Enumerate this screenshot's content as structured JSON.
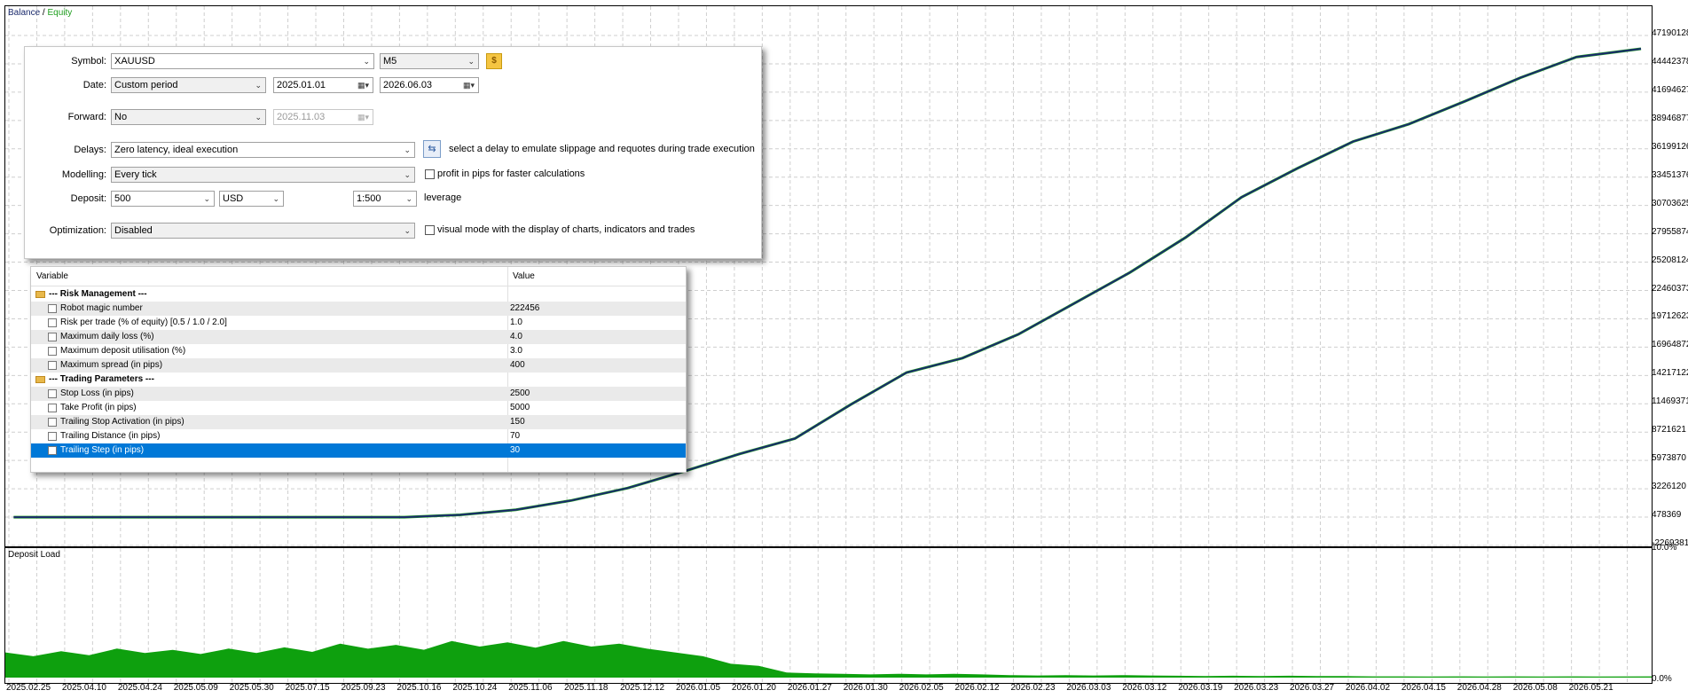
{
  "chart": {
    "legend_balance": "Balance",
    "legend_sep": " / ",
    "legend_equity": "Equity",
    "y_labels": [
      "47190128",
      "44442378",
      "41694627",
      "38946877",
      "36199126",
      "33451376",
      "30703625",
      "27955874",
      "25208124",
      "22460373",
      "19712623",
      "16964872",
      "14217122",
      "11469371",
      "8721621",
      "5973870",
      "3226120",
      "478369",
      "-2269381"
    ],
    "load_title": "Deposit Load",
    "load_y_top": "10.0%",
    "load_y_bottom": "0.0%",
    "x_labels": [
      "2025.02.25",
      "2025.04.10",
      "2025.04.24",
      "2025.05.09",
      "2025.05.30",
      "2025.07.15",
      "2025.09.23",
      "2025.10.16",
      "2025.10.24",
      "2025.11.06",
      "2025.11.18",
      "2025.12.12",
      "2026.01.05",
      "2026.01.20",
      "2026.01.27",
      "2026.01.30",
      "2026.02.05",
      "2026.02.12",
      "2026.02.23",
      "2026.03.03",
      "2026.03.12",
      "2026.03.19",
      "2026.03.23",
      "2026.03.27",
      "2026.04.02",
      "2026.04.15",
      "2026.04.28",
      "2026.05.08",
      "2026.05.21"
    ],
    "balance_color": "#1a2a6c",
    "equity_color": "#1c9e1c",
    "load_color": "#0ea00e"
  },
  "chart_data": {
    "type": "line",
    "series": [
      {
        "name": "Balance",
        "values": [
          478369,
          478369,
          478369,
          478369,
          478369,
          478369,
          478369,
          478369,
          700000,
          1200000,
          2100000,
          3300000,
          4900000,
          6600000,
          8100000,
          11400000,
          14500000,
          15900000,
          18200000,
          21200000,
          24200000,
          27600000,
          31500000,
          34300000,
          36900000,
          38600000,
          40800000,
          43100000,
          45100000
        ]
      },
      {
        "name": "Equity",
        "values": [
          478369,
          478369,
          478369,
          478369,
          478369,
          478369,
          478369,
          478369,
          700000,
          1200000,
          2100000,
          3300000,
          4900000,
          6600000,
          8100000,
          11400000,
          14500000,
          15900000,
          18200000,
          21200000,
          24200000,
          27600000,
          31500000,
          34300000,
          36900000,
          38600000,
          40800000,
          43100000,
          45100000
        ]
      }
    ],
    "ylim": [
      -2269381,
      47190128
    ],
    "deposit_load": {
      "ylim": [
        0,
        10.0
      ],
      "values": [
        2.0,
        2.1,
        2.3,
        2.2,
        2.3,
        2.4,
        2.7,
        2.6,
        2.9,
        2.8,
        2.9,
        2.7,
        2.0,
        1.1,
        0.4,
        0.3,
        0.3,
        0.3,
        0.2,
        0.2,
        0.2,
        0.15,
        0.15,
        0.15,
        0.12,
        0.1,
        0.1,
        0.1,
        0.1
      ]
    }
  },
  "settings": {
    "symbol_label": "Symbol:",
    "symbol_value": "XAUUSD",
    "timeframe": "M5",
    "date_label": "Date:",
    "date_mode": "Custom period",
    "date_from": "2025.01.01",
    "date_to": "2026.06.03",
    "forward_label": "Forward:",
    "forward_value": "No",
    "forward_date": "2025.11.03",
    "delays_label": "Delays:",
    "delays_value": "Zero latency, ideal execution",
    "delays_note": "select a delay to emulate slippage and requotes during trade execution",
    "modelling_label": "Modelling:",
    "modelling_value": "Every tick",
    "modelling_note": "profit in pips for faster calculations",
    "deposit_label": "Deposit:",
    "deposit_value": "500",
    "currency": "USD",
    "leverage_value": "1:500",
    "leverage_label": "leverage",
    "optimization_label": "Optimization:",
    "optimization_value": "Disabled",
    "visual_note": "visual mode with the display of charts, indicators and trades"
  },
  "params": {
    "col_variable": "Variable",
    "col_value": "Value",
    "group1": "--- Risk Management ---",
    "group2": "--- Trading Parameters ---",
    "rows": [
      {
        "name": "Robot magic number",
        "value": "222456"
      },
      {
        "name": "Risk per trade (% of equity) [0.5 / 1.0 / 2.0]",
        "value": "1.0"
      },
      {
        "name": "Maximum daily loss (%)",
        "value": "4.0"
      },
      {
        "name": "Maximum deposit utilisation (%)",
        "value": "3.0"
      },
      {
        "name": "Maximum spread (in pips)",
        "value": "400"
      },
      {
        "name": "Stop Loss (in pips)",
        "value": "2500"
      },
      {
        "name": "Take Profit (in pips)",
        "value": "5000"
      },
      {
        "name": "Trailing Stop Activation (in pips)",
        "value": "150"
      },
      {
        "name": "Trailing Distance (in pips)",
        "value": "70"
      },
      {
        "name": "Trailing Step (in pips)",
        "value": "30"
      }
    ]
  }
}
